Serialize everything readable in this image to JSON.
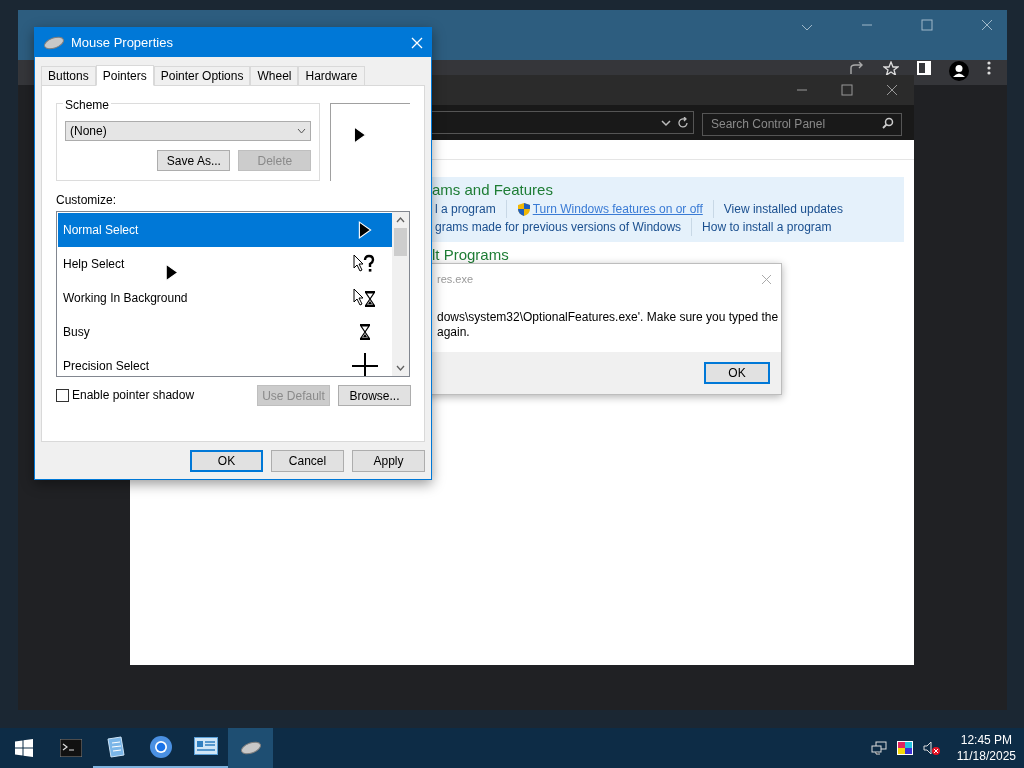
{
  "control_panel": {
    "search": {
      "placeholder": "Search Control Panel"
    },
    "sections": [
      {
        "heading": "ams and Features",
        "link_rows": [
          [
            {
              "text": "l a program",
              "shield": false,
              "hovered": false
            },
            {
              "text": "Turn Windows features on or off",
              "shield": true,
              "hovered": true
            },
            {
              "text": "View installed updates",
              "shield": false,
              "hovered": false
            }
          ],
          [
            {
              "text": "grams made for previous versions of Windows",
              "shield": false,
              "hovered": false
            },
            {
              "text": "How to install a program",
              "shield": false,
              "hovered": false
            }
          ]
        ]
      },
      {
        "heading": "lt Programs"
      }
    ]
  },
  "error_dialog": {
    "title": "res.exe",
    "message_lines": [
      "dows\\system32\\OptionalFeatures.exe'. Make sure you typed the",
      "again."
    ],
    "ok": "OK"
  },
  "mouse_properties": {
    "title": "Mouse Properties",
    "tabs": [
      {
        "label": "Buttons",
        "selected": false
      },
      {
        "label": "Pointers",
        "selected": true
      },
      {
        "label": "Pointer Options",
        "selected": false
      },
      {
        "label": "Wheel",
        "selected": false
      },
      {
        "label": "Hardware",
        "selected": false
      }
    ],
    "scheme": {
      "label": "Scheme",
      "value": "(None)",
      "buttons": [
        {
          "label": "Save As...",
          "disabled": false
        },
        {
          "label": "Delete",
          "disabled": true
        }
      ]
    },
    "customize_label": "Customize:",
    "pointers": [
      {
        "name": "Normal Select",
        "kind": "arrow",
        "selected": true
      },
      {
        "name": "Help Select",
        "kind": "help",
        "selected": false
      },
      {
        "name": "Working In Background",
        "kind": "working",
        "selected": false
      },
      {
        "name": "Busy",
        "kind": "busy",
        "selected": false
      },
      {
        "name": "Precision Select",
        "kind": "cross",
        "selected": false
      }
    ],
    "shadow": {
      "label": "Enable pointer shadow",
      "checked": false
    },
    "buttons": [
      {
        "label": "Use Default",
        "disabled": true
      },
      {
        "label": "Browse...",
        "disabled": false
      }
    ],
    "footer": [
      {
        "label": "OK",
        "default": true
      },
      {
        "label": "Cancel",
        "default": false
      },
      {
        "label": "Apply",
        "default": false
      }
    ]
  },
  "taskbar": {
    "apps": [
      {
        "kind": "terminal",
        "running": false,
        "active": false
      },
      {
        "kind": "notepad",
        "running": true,
        "active": false
      },
      {
        "kind": "browser",
        "running": true,
        "active": false
      },
      {
        "kind": "control_panel",
        "running": true,
        "active": false
      },
      {
        "kind": "mouse",
        "running": false,
        "active": true
      }
    ],
    "time": "12:45 PM",
    "date": "11/18/2025"
  }
}
